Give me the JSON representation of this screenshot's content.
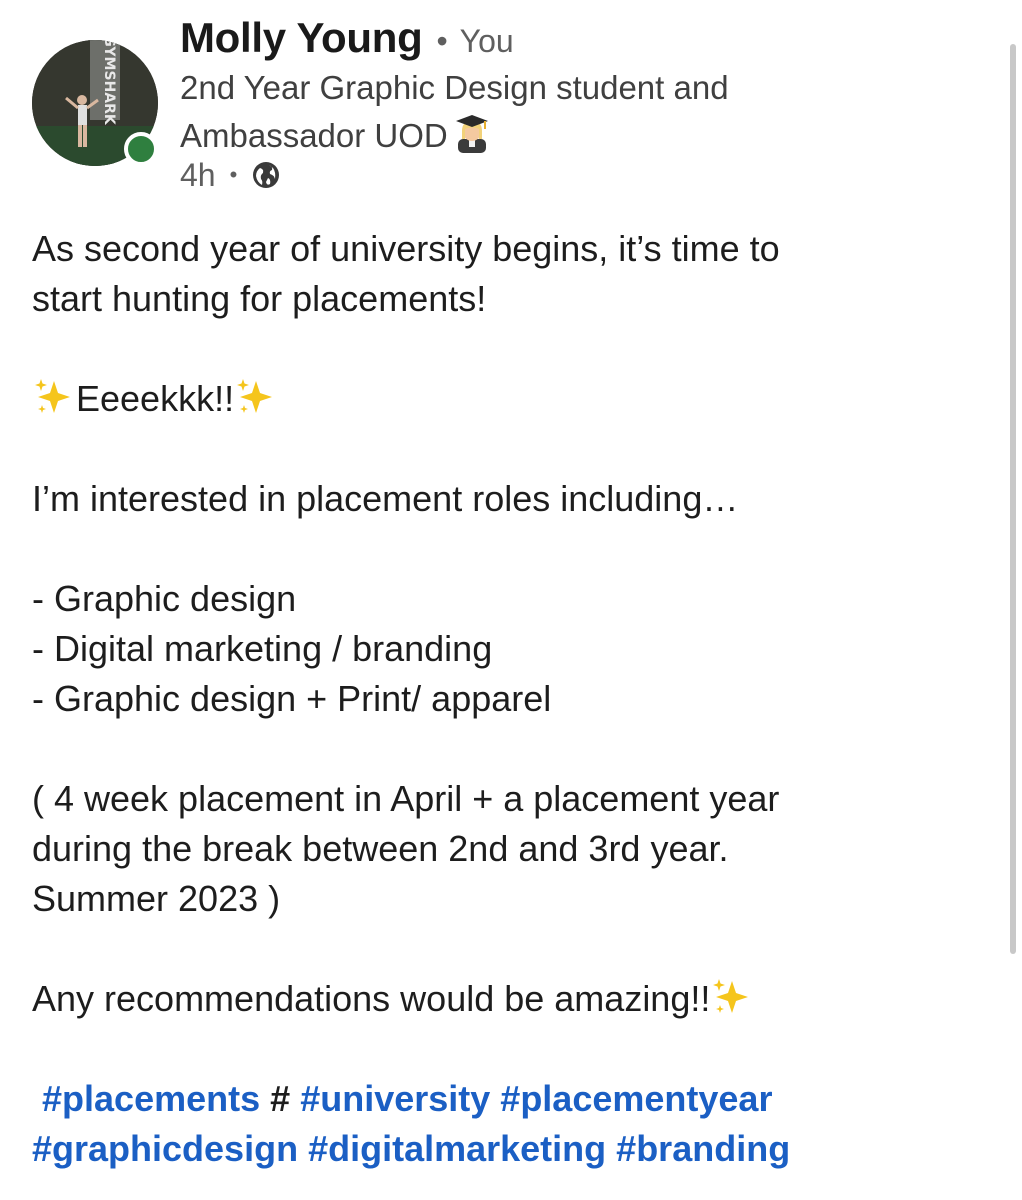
{
  "author": {
    "name": "Molly Young",
    "separator": "•",
    "relationship": "You",
    "headline": "2nd Year Graphic Design student and Ambassador UOD",
    "headline_emoji": "student-emoji",
    "avatar_banner_text": "GYMSHARK",
    "online_status_color": "#2f7f3f"
  },
  "meta": {
    "time": "4h",
    "separator": "•",
    "visibility_icon": "globe-icon"
  },
  "post": {
    "line1": "As second year of university begins, it’s time to",
    "line2": "start hunting for placements!",
    "exclaim": "Eeeekkk!!",
    "intro": "I’m interested in placement roles including…",
    "roles": [
      "- Graphic design",
      "- Digital marketing / branding",
      "- Graphic design + Print/ apparel"
    ],
    "note_lines": [
      "( 4 week placement in April + a placement year",
      "during the break between 2nd and 3rd year.",
      "Summer 2023 )"
    ],
    "closing": "Any recommendations would be amazing!!",
    "hashtags_line1": [
      "#placements",
      "#",
      "#university",
      "#placementyear"
    ],
    "hashtags_line2": [
      "#graphicdesign",
      "#digitalmarketing",
      "#branding"
    ]
  },
  "colors": {
    "hashtag": "#1b5fc4",
    "text": "#1d1d1d",
    "secondary": "#5f5f5f"
  }
}
